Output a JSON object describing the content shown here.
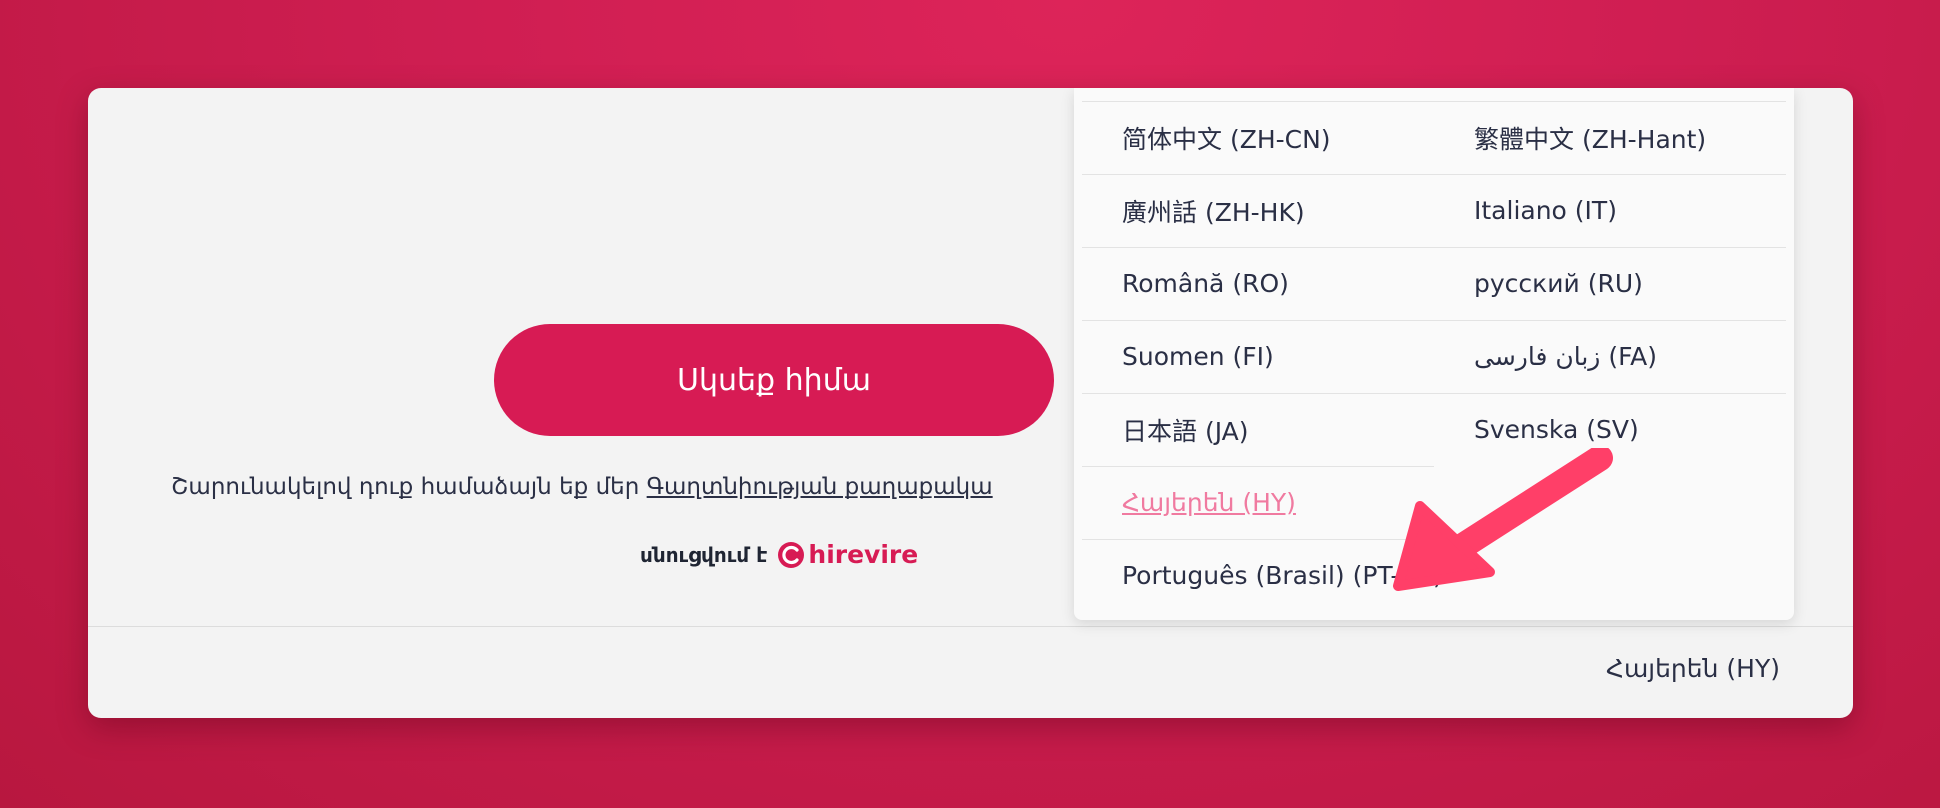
{
  "start_button": {
    "label": "Սկսեք հիմա"
  },
  "terms": {
    "prefix": "Շարունակելով դուք համաձայն եք մեր ",
    "link": "Գաղտնիության քաղաքակա"
  },
  "powered_by": {
    "label": "սնուցվում է",
    "brand": "hirevire"
  },
  "current_language": "Հայերեն (HY)",
  "language_menu": {
    "items": [
      {
        "label": "简体中文 (ZH-CN)"
      },
      {
        "label": "繁體中文 (ZH-Hant)"
      },
      {
        "label": "廣州話 (ZH-HK)"
      },
      {
        "label": "Italiano (IT)"
      },
      {
        "label": "Română (RO)"
      },
      {
        "label": "русский (RU)"
      },
      {
        "label": "Suomen (FI)"
      },
      {
        "label": "زبان فارسی (FA)"
      },
      {
        "label": "日本語 (JA)"
      },
      {
        "label": "Svenska (SV)"
      },
      {
        "label": "Հայերեն (HY)"
      },
      {
        "label": "Português (Brasil) (PT-BR)"
      }
    ]
  },
  "colors": {
    "brand": "#d71b54",
    "highlight": "#f07aa0",
    "arrow": "#ff3f68"
  }
}
